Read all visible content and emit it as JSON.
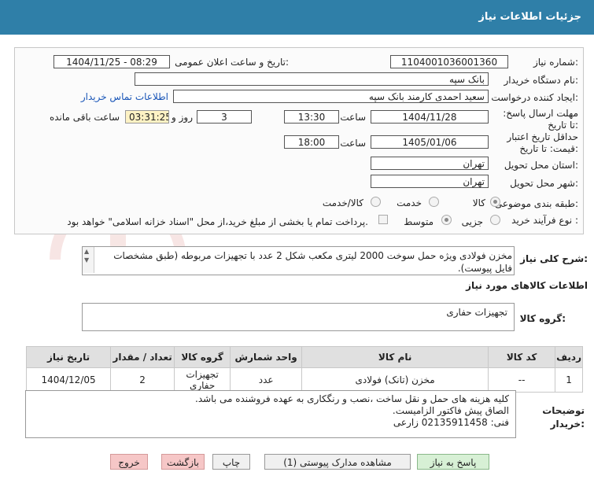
{
  "header": {
    "title": "جزئیات اطلاعات نیاز"
  },
  "form": {
    "need_number_label": "شماره نیاز:",
    "need_number": "1104001036001360",
    "announce_label": "تاریخ و ساعت اعلان عمومی:",
    "announce_value": "1404/11/25 - 08:29",
    "buyer_org_label": "نام دستگاه خریدار:",
    "buyer_org": "بانک سپه",
    "creator_label": "ایجاد کننده درخواست:",
    "creator": "سعید احمدی کارمند بانک سپه",
    "contact_link": "اطلاعات تماس خریدار",
    "deadline_label": "مهلت ارسال پاسخ: تا تاریخ:",
    "deadline_date": "1404/11/28",
    "time_label": "ساعت",
    "deadline_time": "13:30",
    "days": "3",
    "days_label": "روز و",
    "remaining": "03:31:25",
    "remaining_label": "ساعت باقی مانده",
    "validity_label": "حداقل تاریخ اعتبار قیمت: تا تاریخ:",
    "validity_date": "1405/01/06",
    "validity_time": "18:00",
    "province_label": "استان محل تحویل:",
    "province": "تهران",
    "city_label": "شهر محل تحویل:",
    "city": "تهران",
    "category_label": "طبقه بندی موضوعی:",
    "category_options": [
      "کالا",
      "خدمت",
      "کالا/خدمت"
    ],
    "process_label": "نوع فرآیند خرید :",
    "process_options": [
      "جزیی",
      "متوسط"
    ],
    "payment_note": "پرداخت تمام یا بخشی از مبلغ خرید،از محل \"اسناد خزانه اسلامی\" خواهد بود."
  },
  "description": {
    "label": "شرح کلی نیاز:",
    "text": "مخزن فولادی ویژه حمل سوخت 2000 لیتری مکعب شکل 2 عدد با تجهیزات مربوطه (طبق مشخصات فایل پیوست)."
  },
  "goods": {
    "section_title": "اطلاعات کالاهای مورد نیاز",
    "group_label": "گروه کالا:",
    "group_value": "تجهیزات حفاری",
    "columns": [
      "ردیف",
      "کد کالا",
      "نام کالا",
      "واحد شمارش",
      "گروه کالا",
      "تعداد / مقدار",
      "تاریخ نیاز"
    ],
    "rows": [
      {
        "row": "1",
        "code": "--",
        "name": "مخزن (تانک) فولادی",
        "unit": "عدد",
        "group": "تجهیزات حفاری",
        "qty": "2",
        "date": "1404/12/05"
      }
    ]
  },
  "buyer_notes": {
    "label": "توضیحات خریدار:",
    "line1": "کلیه هزینه های حمل و نقل ساخت ،نصب و رنگکاری به عهده فروشنده می باشد.",
    "line2": "الصاق پیش فاکتور الزامیست.",
    "line3": "فنی: 02135911458 زارعی"
  },
  "buttons": {
    "reply": "پاسخ به نیاز",
    "attachments": "مشاهده مدارک پیوستی (1)",
    "print": "چاپ",
    "back": "بازگشت",
    "exit": "خروج"
  },
  "colors": {
    "header": "#2f7fa8",
    "reply_button": "#d7f0d5",
    "exit_button": "#f6c7c7",
    "remaining_bg": "#fdf2c4"
  }
}
